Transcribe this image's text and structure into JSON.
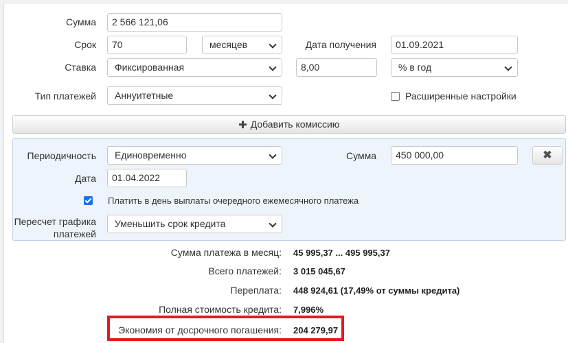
{
  "form": {
    "sum": {
      "label": "Сумма",
      "value": "2 566 121,06"
    },
    "term": {
      "label": "Срок",
      "value": "70",
      "unit": "месяцев"
    },
    "date_received": {
      "label": "Дата получения",
      "value": "01.09.2021"
    },
    "rate": {
      "label": "Ставка",
      "type": "Фиксированная",
      "value": "8,00",
      "unit": "% в год"
    },
    "payment_type": {
      "label": "Тип платежей",
      "value": "Аннуитетные"
    },
    "advanced": {
      "label": "Расширенные настройки",
      "checked": false
    }
  },
  "add_commission": {
    "label": "Добавить комиссию"
  },
  "commission": {
    "periodicity": {
      "label": "Периодичность",
      "value": "Единовременно"
    },
    "sum": {
      "label": "Сумма",
      "value": "450 000,00"
    },
    "date": {
      "label": "Дата",
      "value": "01.04.2022"
    },
    "pay_on_payment_day": {
      "label": "Платить в день выплаты очередного ежемесячного платежа",
      "checked": true
    },
    "recalc": {
      "label_line1": "Пересчет графика",
      "label_line2": "платежей",
      "value": "Уменьшить срок кредита"
    },
    "remove_label": "✖"
  },
  "results": [
    {
      "label": "Сумма платежа в месяц:",
      "value": "45 995,37 ... 495 995,37"
    },
    {
      "label": "Всего платежей:",
      "value": "3 015 045,67"
    },
    {
      "label": "Переплата:",
      "value": "448 924,61 (17,49% от суммы кредита)"
    },
    {
      "label": "Полная стоимость кредита:",
      "value": "7,996%"
    },
    {
      "label": "Экономия от досрочного погашения:",
      "value": "204 279,97"
    }
  ],
  "colors": {
    "highlight": "#e01b24",
    "checkbox_on": "#1a73e8",
    "commission_bg": "#eef4fb"
  }
}
